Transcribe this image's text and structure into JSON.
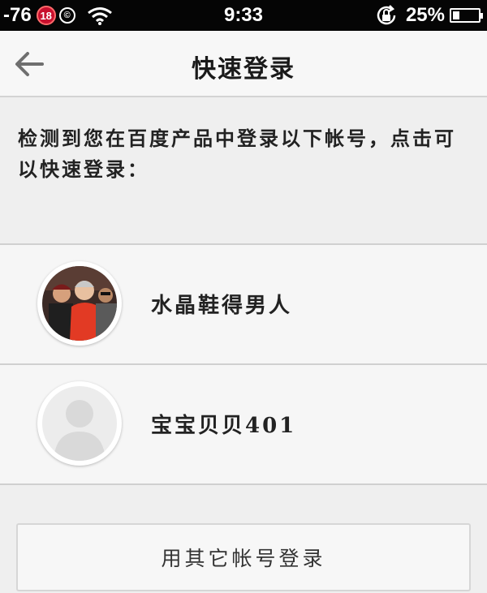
{
  "status_bar": {
    "signal": "-76",
    "badge": "18",
    "copyright_symbol": "©",
    "time": "9:33",
    "battery_percent": "25%",
    "battery_level": 0.25,
    "icons": [
      "18-badge-icon",
      "copyright-icon",
      "wifi-icon",
      "rotation-lock-icon",
      "battery-icon"
    ]
  },
  "nav": {
    "title": "快速登录",
    "back_icon": "back-arrow-icon"
  },
  "instruction": "检测到您在百度产品中登录以下帐号，点击可以快速登录：",
  "accounts": [
    {
      "name": "水晶鞋得男人",
      "avatar": "photo-avatar"
    },
    {
      "name": "宝宝贝贝401",
      "avatar": "default-avatar-icon"
    }
  ],
  "other_account_button": "用其它帐号登录"
}
